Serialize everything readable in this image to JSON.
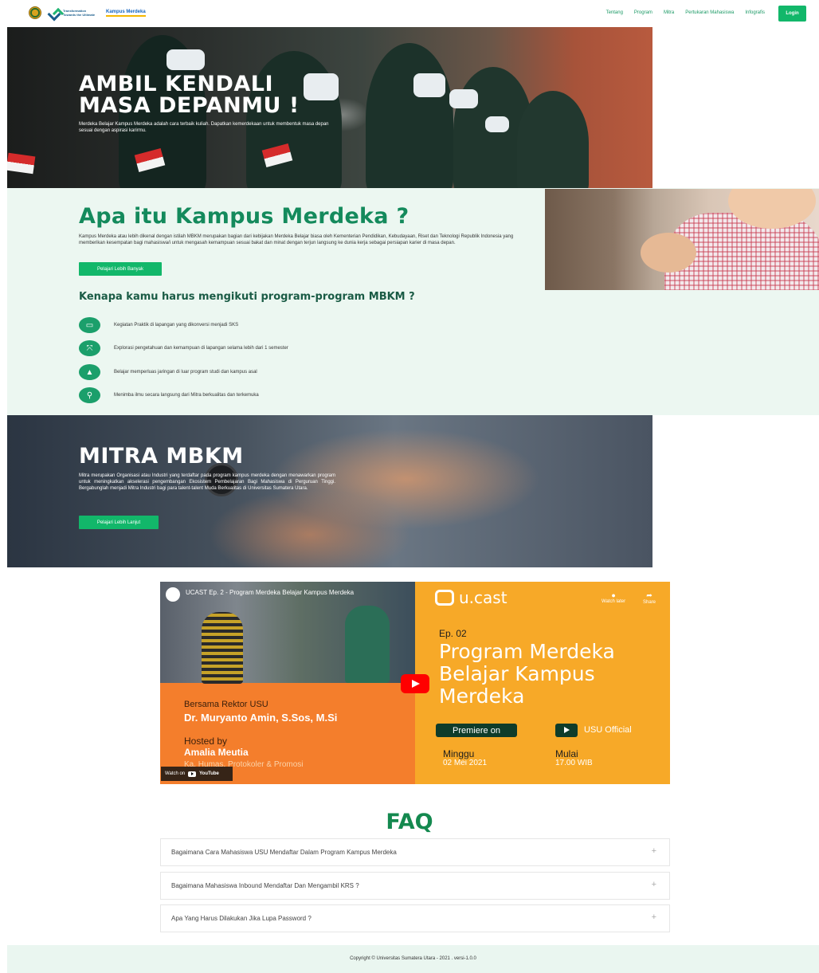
{
  "navbar": {
    "logo_text": "Transformation Towards the Ultimate",
    "logo_km": "Kampus Merdeka",
    "links": [
      "Tentang",
      "Program",
      "Mitra",
      "Pertukaran Mahasiswa",
      "Infografis"
    ],
    "login_label": "Login"
  },
  "hero": {
    "title_line1": "AMBIL KENDALI",
    "title_line2": "MASA DEPANMU !",
    "subtitle": "Merdeka Belajar Kampus Merdeka adalah cara terbaik kuliah. Dapatkan kemerdekaan untuk membentuk masa depan sesuai dengan aspirasi karirmu."
  },
  "apa_itu": {
    "title": "Apa itu Kampus Merdeka ?",
    "description": "Kampus Merdeka atau lebih dikenal dengan istilah MBKM merupakan bagian dari kebijakan Merdeka Belajar biasa oleh Kementerian Pendidikan, Kebudayaan, Riset dan Teknologi Republik Indonesia yang memberikan kesempatan bagi mahasiswa/i untuk mengasah kemampuan sesuai bakat dan minat dengan terjun langsung ke dunia kerja sebagai persiapan karier di masa depan.",
    "button_label": "Pelajari Lebih Banyak",
    "why_title": "Kenapa kamu harus mengikuti program-program MBKM ?",
    "reasons": [
      {
        "icon": "briefcase-icon",
        "glyph": "▭",
        "label": "Kegiatan Praktik di lapangan yang dikonversi menjadi SKS"
      },
      {
        "icon": "expand-icon",
        "glyph": "⤧",
        "label": "Explorasi pengetahuan dan kemampuan di lapangan selama lebih dari 1 semester"
      },
      {
        "icon": "network-icon",
        "glyph": "▲",
        "label": "Belajar memperluas jaringan di luar program studi dan kampus asal"
      },
      {
        "icon": "lightbulb-icon",
        "glyph": "⚲",
        "label": "Menimba ilmu secara langsung dari Mitra berkualitas dan terkemuka"
      }
    ]
  },
  "mitra": {
    "title": "MITRA MBKM",
    "description": "Mitra merupakan Organisasi atau Industri yang terdaftar pada program kampus merdeka dengan menawarkan program untuk meningkatkan akselerasi pengembangan Ekosistem Pembelajaran Bagi Mahasiswa di Perguruan Tinggi. Bergabunglah menjadi Mitra Industri bagi para talent-talent Muda Berkualitas di Universitas Sumatera Utara.",
    "button_label": "Pelajari Lebih Lanjut"
  },
  "video": {
    "title": "UCAST Ep. 2 - Program Merdeka Belajar Kampus Merdeka",
    "brand": "u.cast",
    "watch_later": "Watch later",
    "share": "Share",
    "episode": "Ep. 02",
    "program_title": "Program Merdeka Belajar Kampus Merdeka",
    "bersama": "Bersama Rektor USU",
    "rektor": "Dr. Muryanto Amin, S.Sos, M.Si",
    "hosted_by": "Hosted by",
    "host": "Amalia Meutia",
    "host_role": "Ka. Humas, Protokoler & Promosi",
    "premiere": "Premiere on",
    "channel": "USU Official",
    "day_label": "Minggu",
    "date": "02 Mei 2021",
    "start_label": "Mulai",
    "time": "17.00 WIB",
    "watch_on": "Watch on",
    "youtube": "YouTube"
  },
  "faq": {
    "title": "FAQ",
    "items": [
      "Bagaimana Cara Mahasiswa USU Mendaftar Dalam Program Kampus Merdeka",
      "Bagaimana Mahasiswa Inbound Mendaftar Dan Mengambil KRS ?",
      "Apa Yang Harus Dilakukan Jika Lupa Password ?"
    ],
    "expand_glyph": "+"
  },
  "footer": {
    "copyright": "Copyright © Universitas Sumatera Utara - 2021 . versi-1.0.0"
  },
  "colors": {
    "primary_green": "#12b76a",
    "title_green": "#148a5c",
    "section_bg": "#ecf7f1"
  }
}
